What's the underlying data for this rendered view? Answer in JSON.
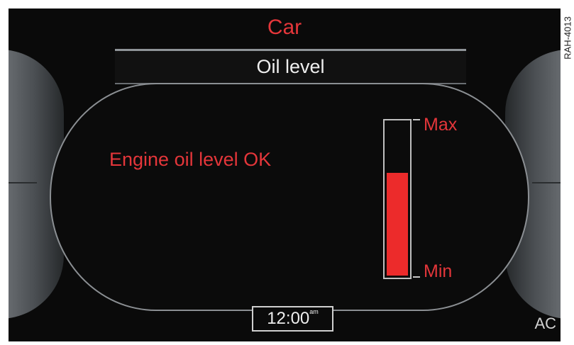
{
  "header": {
    "title": "Car"
  },
  "menu": {
    "selected_label": "Oil level"
  },
  "status": {
    "message": "Engine oil level OK"
  },
  "oil_gauge": {
    "max_label": "Max",
    "min_label": "Min",
    "level_fraction": 0.67,
    "fill_color": "#ec2b2b"
  },
  "footer": {
    "clock_time": "12:00",
    "clock_suffix": "am",
    "ac_label": "AC"
  },
  "image_code": "RAH-4013",
  "colors": {
    "accent_red": "#e4363a",
    "background": "#0a0a0a"
  }
}
